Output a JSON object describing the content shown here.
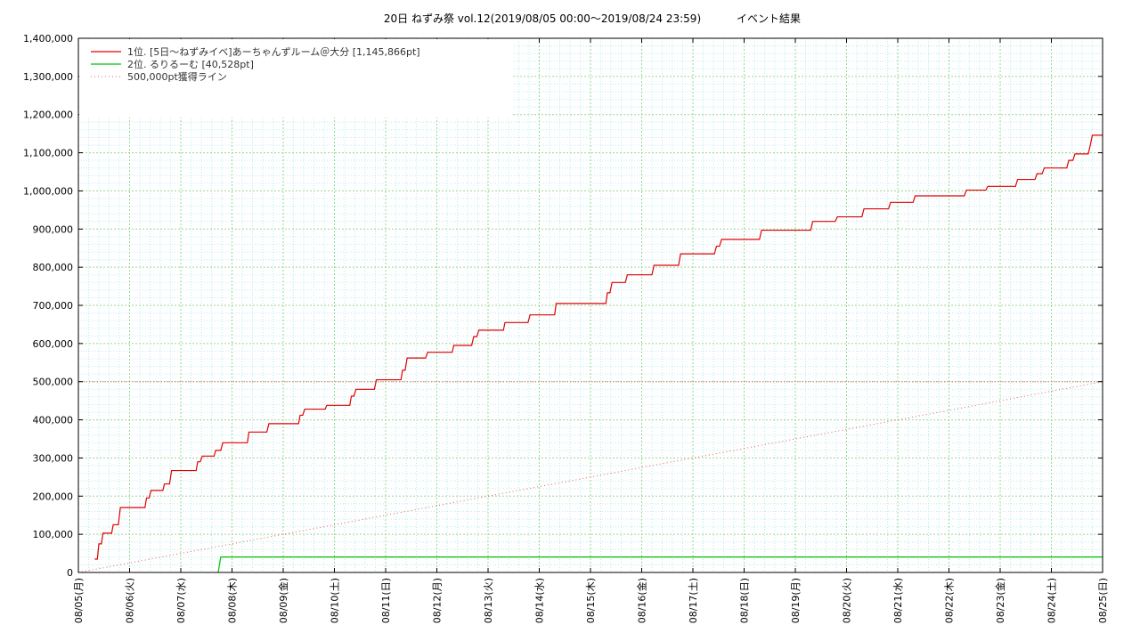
{
  "chart_data": {
    "type": "line",
    "title": "20日 ねずみ祭 vol.12(2019/08/05 00:00〜2019/08/24 23:59)",
    "subtitle": "イベント結果",
    "xlabel": "",
    "ylabel": "",
    "xlim": [
      0,
      20
    ],
    "ylim": [
      0,
      1400000
    ],
    "grid": true,
    "legend_position": "top-left",
    "x_ticks": [
      "08/05(月)",
      "08/06(火)",
      "08/07(水)",
      "08/08(木)",
      "08/09(金)",
      "08/10(土)",
      "08/11(日)",
      "08/12(月)",
      "08/13(火)",
      "08/14(水)",
      "08/15(木)",
      "08/16(金)",
      "08/17(土)",
      "08/18(日)",
      "08/19(月)",
      "08/20(火)",
      "08/21(水)",
      "08/22(木)",
      "08/23(金)",
      "08/24(土)",
      "08/25(日)"
    ],
    "y_ticks": [
      "0",
      "100,000",
      "200,000",
      "300,000",
      "400,000",
      "500,000",
      "600,000",
      "700,000",
      "800,000",
      "900,000",
      "1,000,000",
      "1,100,000",
      "1,200,000",
      "1,300,000",
      "1,400,000"
    ],
    "series": [
      {
        "name": "1位. [5日〜ねずみイベ]あーちゃんずルーム＠大分 [1,145,866pt]",
        "color": "#e00000",
        "style": "solid",
        "points": [
          [
            0.32,
            35000
          ],
          [
            0.37,
            35000
          ],
          [
            0.4,
            75000
          ],
          [
            0.45,
            75000
          ],
          [
            0.48,
            103000
          ],
          [
            0.65,
            103000
          ],
          [
            0.68,
            125000
          ],
          [
            0.78,
            125000
          ],
          [
            0.82,
            170000
          ],
          [
            1.3,
            170000
          ],
          [
            1.33,
            195000
          ],
          [
            1.38,
            195000
          ],
          [
            1.42,
            215000
          ],
          [
            1.65,
            215000
          ],
          [
            1.68,
            232000
          ],
          [
            1.78,
            232000
          ],
          [
            1.82,
            267000
          ],
          [
            2.3,
            267000
          ],
          [
            2.33,
            290000
          ],
          [
            2.38,
            290000
          ],
          [
            2.42,
            305000
          ],
          [
            2.65,
            305000
          ],
          [
            2.68,
            320000
          ],
          [
            2.78,
            320000
          ],
          [
            2.82,
            340000
          ],
          [
            3.3,
            340000
          ],
          [
            3.33,
            368000
          ],
          [
            3.68,
            368000
          ],
          [
            3.72,
            390000
          ],
          [
            4.3,
            390000
          ],
          [
            4.33,
            412000
          ],
          [
            4.38,
            412000
          ],
          [
            4.42,
            428000
          ],
          [
            4.82,
            428000
          ],
          [
            4.85,
            438000
          ],
          [
            5.3,
            438000
          ],
          [
            5.33,
            462000
          ],
          [
            5.38,
            462000
          ],
          [
            5.42,
            480000
          ],
          [
            5.78,
            480000
          ],
          [
            5.82,
            505000
          ],
          [
            6.3,
            505000
          ],
          [
            6.33,
            530000
          ],
          [
            6.38,
            530000
          ],
          [
            6.42,
            562000
          ],
          [
            6.78,
            562000
          ],
          [
            6.82,
            577000
          ],
          [
            7.3,
            577000
          ],
          [
            7.33,
            595000
          ],
          [
            7.68,
            595000
          ],
          [
            7.72,
            618000
          ],
          [
            7.78,
            618000
          ],
          [
            7.82,
            635000
          ],
          [
            8.3,
            635000
          ],
          [
            8.33,
            655000
          ],
          [
            8.78,
            655000
          ],
          [
            8.82,
            675000
          ],
          [
            9.3,
            675000
          ],
          [
            9.33,
            705000
          ],
          [
            10.3,
            705000
          ],
          [
            10.33,
            733000
          ],
          [
            10.38,
            733000
          ],
          [
            10.42,
            760000
          ],
          [
            10.68,
            760000
          ],
          [
            10.72,
            780000
          ],
          [
            11.2,
            780000
          ],
          [
            11.24,
            805000
          ],
          [
            11.72,
            805000
          ],
          [
            11.76,
            835000
          ],
          [
            12.42,
            835000
          ],
          [
            12.46,
            855000
          ],
          [
            12.52,
            855000
          ],
          [
            12.56,
            873000
          ],
          [
            13.3,
            873000
          ],
          [
            13.34,
            897000
          ],
          [
            14.3,
            897000
          ],
          [
            14.34,
            920000
          ],
          [
            14.78,
            920000
          ],
          [
            14.82,
            932000
          ],
          [
            15.3,
            932000
          ],
          [
            15.34,
            953000
          ],
          [
            15.82,
            953000
          ],
          [
            15.86,
            970000
          ],
          [
            16.3,
            970000
          ],
          [
            16.34,
            987000
          ],
          [
            17.3,
            987000
          ],
          [
            17.34,
            1002000
          ],
          [
            17.72,
            1002000
          ],
          [
            17.76,
            1012000
          ],
          [
            18.3,
            1012000
          ],
          [
            18.34,
            1030000
          ],
          [
            18.68,
            1030000
          ],
          [
            18.72,
            1045000
          ],
          [
            18.82,
            1045000
          ],
          [
            18.86,
            1060000
          ],
          [
            19.3,
            1060000
          ],
          [
            19.34,
            1080000
          ],
          [
            19.42,
            1080000
          ],
          [
            19.46,
            1097000
          ],
          [
            19.72,
            1097000
          ],
          [
            19.76,
            1120000
          ],
          [
            19.8,
            1145866
          ],
          [
            20.0,
            1145866
          ]
        ]
      },
      {
        "name": "2位. るりるーむ [40,528pt]",
        "color": "#00c000",
        "style": "solid",
        "points": [
          [
            2.73,
            0
          ],
          [
            2.78,
            40528
          ],
          [
            20.0,
            40528
          ]
        ]
      },
      {
        "name": "500,000pt獲得ライン",
        "color": "#e00000",
        "style": "dotted",
        "points": [
          [
            0,
            0
          ],
          [
            20,
            500000
          ]
        ]
      }
    ],
    "reference_lines": [
      {
        "y": 500000,
        "color": "#e07070",
        "style": "dotted"
      }
    ]
  }
}
